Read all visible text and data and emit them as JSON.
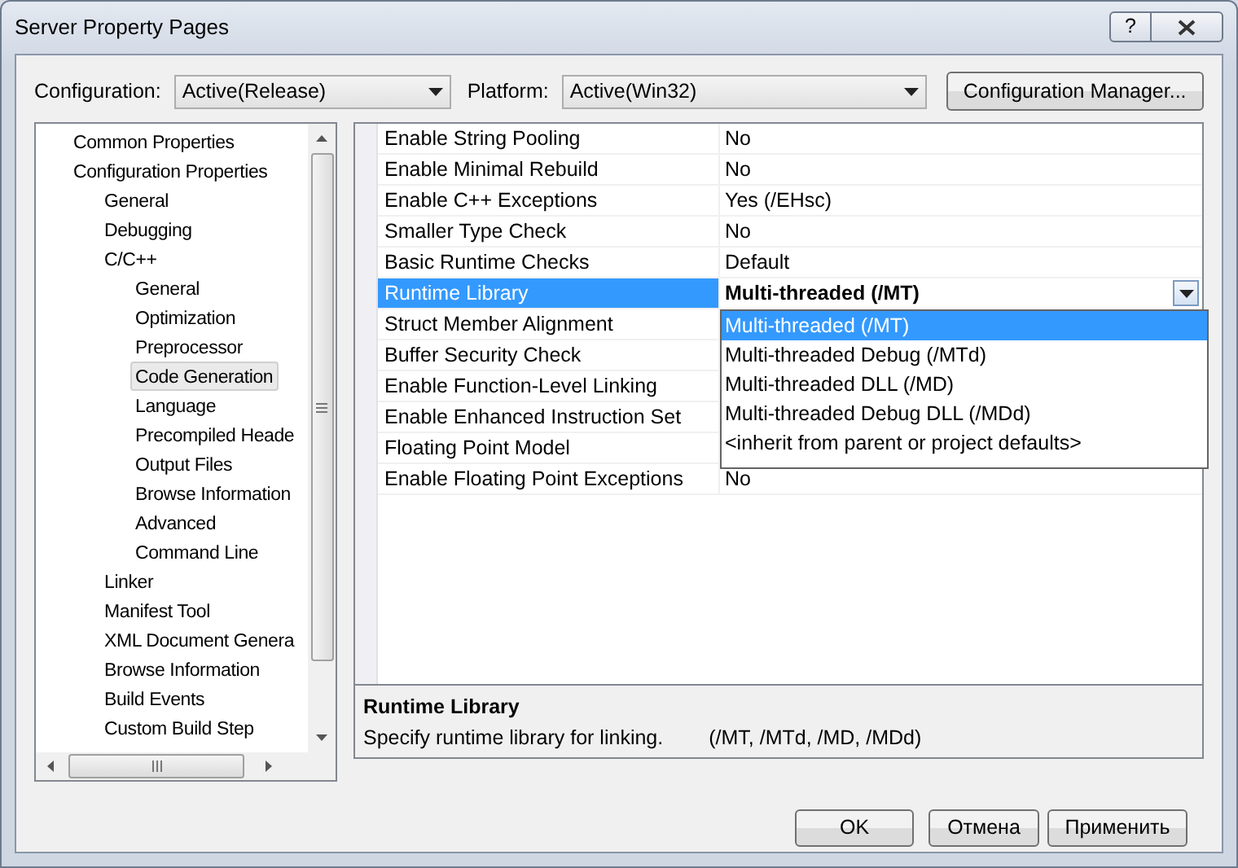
{
  "window": {
    "title": "Server Property Pages",
    "help_button": "?"
  },
  "config": {
    "configuration_label": "Configuration:",
    "configuration_value": "Active(Release)",
    "platform_label": "Platform:",
    "platform_value": "Active(Win32)",
    "manager_button": "Configuration Manager..."
  },
  "tree": [
    {
      "label": "Common Properties",
      "selected": false
    },
    {
      "label": "Configuration Properties",
      "selected": false,
      "children": [
        {
          "label": "General",
          "selected": false
        },
        {
          "label": "Debugging",
          "selected": false
        },
        {
          "label": "C/C++",
          "selected": false,
          "children": [
            {
              "label": "General",
              "selected": false
            },
            {
              "label": "Optimization",
              "selected": false
            },
            {
              "label": "Preprocessor",
              "selected": false
            },
            {
              "label": "Code Generation",
              "selected": true
            },
            {
              "label": "Language",
              "selected": false
            },
            {
              "label": "Precompiled Heade",
              "selected": false
            },
            {
              "label": "Output Files",
              "selected": false
            },
            {
              "label": "Browse Information",
              "selected": false
            },
            {
              "label": "Advanced",
              "selected": false
            },
            {
              "label": "Command Line",
              "selected": false
            }
          ]
        },
        {
          "label": "Linker",
          "selected": false
        },
        {
          "label": "Manifest Tool",
          "selected": false
        },
        {
          "label": "XML Document Genera",
          "selected": false
        },
        {
          "label": "Browse Information",
          "selected": false
        },
        {
          "label": "Build Events",
          "selected": false
        },
        {
          "label": "Custom Build Step",
          "selected": false
        }
      ]
    }
  ],
  "grid": [
    {
      "name": "Enable String Pooling",
      "value": "No",
      "selected": false
    },
    {
      "name": "Enable Minimal Rebuild",
      "value": "No",
      "selected": false
    },
    {
      "name": "Enable C++ Exceptions",
      "value": "Yes (/EHsc)",
      "selected": false
    },
    {
      "name": "Smaller Type Check",
      "value": "No",
      "selected": false
    },
    {
      "name": "Basic Runtime Checks",
      "value": "Default",
      "selected": false
    },
    {
      "name": "Runtime Library",
      "value": "Multi-threaded (/MT)",
      "selected": true
    },
    {
      "name": "Struct Member Alignment",
      "selected": false
    },
    {
      "name": "Buffer Security Check",
      "selected": false
    },
    {
      "name": "Enable Function-Level Linking",
      "selected": false
    },
    {
      "name": "Enable Enhanced Instruction Set",
      "selected": false
    },
    {
      "name": "Floating Point Model",
      "selected": false
    },
    {
      "name": "Enable Floating Point Exceptions",
      "value": "No",
      "selected": false
    }
  ],
  "dropdown": [
    {
      "label": "Multi-threaded (/MT)",
      "selected": true
    },
    {
      "label": "Multi-threaded Debug (/MTd)",
      "selected": false
    },
    {
      "label": "Multi-threaded DLL (/MD)",
      "selected": false
    },
    {
      "label": "Multi-threaded Debug DLL (/MDd)",
      "selected": false
    },
    {
      "label": "<inherit from parent or project defaults>",
      "selected": false
    }
  ],
  "description": {
    "title": "Runtime Library",
    "text": "Specify runtime library for linking.",
    "options": "(/MT, /MTd, /MD, /MDd)"
  },
  "buttons": [
    "OK",
    "Отмена",
    "Применить"
  ]
}
